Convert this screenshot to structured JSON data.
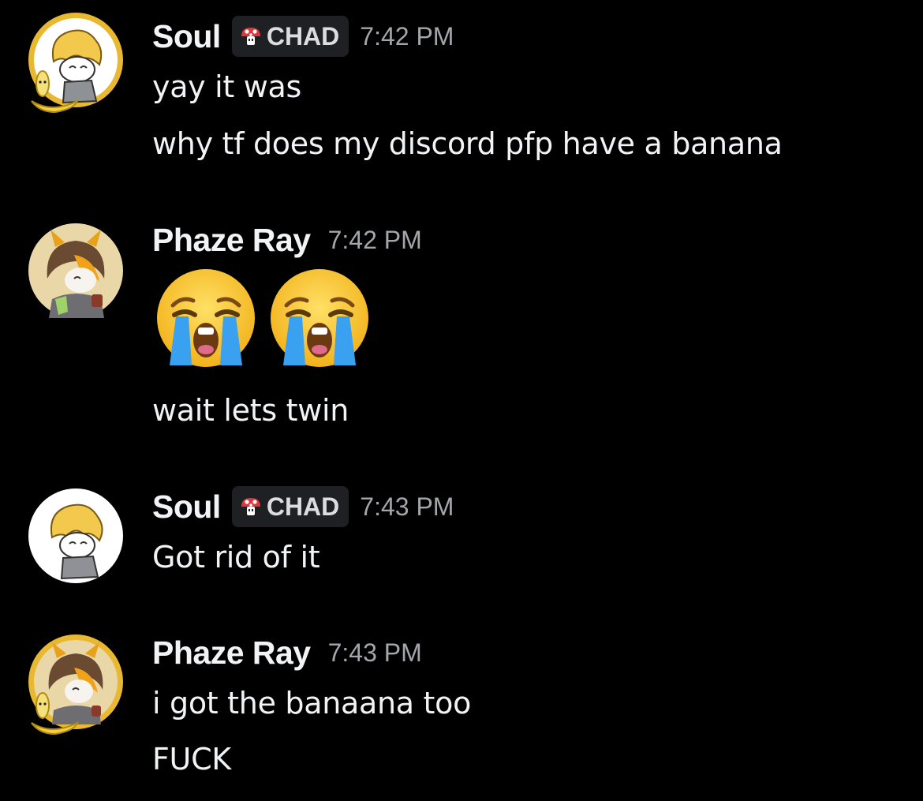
{
  "messages": [
    {
      "username": "Soul",
      "tag": "CHAD",
      "tag_icon": "mushroom-icon",
      "time": "7:42 PM",
      "avatar": "soul-avatar-banana",
      "lines": [
        "yay it was",
        "why tf does my discord pfp have a banana"
      ]
    },
    {
      "username": "Phaze Ray",
      "time": "7:42 PM",
      "avatar": "phaze-ray-avatar",
      "emojis": [
        "loudly-crying-face-emoji",
        "loudly-crying-face-emoji"
      ],
      "lines": [
        "wait lets twin"
      ]
    },
    {
      "username": "Soul",
      "tag": "CHAD",
      "tag_icon": "mushroom-icon",
      "time": "7:43 PM",
      "avatar": "soul-avatar",
      "lines": [
        "Got rid of it"
      ]
    },
    {
      "username": "Phaze Ray",
      "time": "7:43 PM",
      "avatar": "phaze-ray-avatar-banana",
      "lines": [
        "i got the banaana too",
        "FUCK"
      ]
    }
  ],
  "colors": {
    "background": "#000000",
    "text": "#f2f3f5",
    "timestamp": "#a3a6aa",
    "tag_bg": "#1f2023",
    "banana": "#f5cf3c",
    "mushroom_red": "#e2353b"
  }
}
